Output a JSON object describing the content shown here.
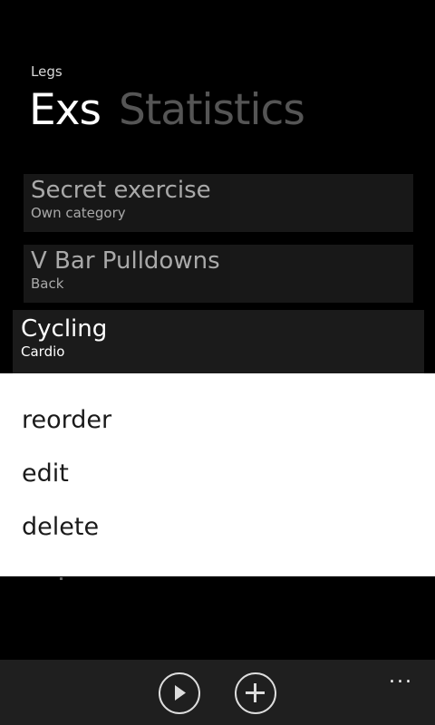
{
  "app": {
    "title": "Legs"
  },
  "pivot": {
    "tabs": [
      {
        "label": "Exs",
        "active": true
      },
      {
        "label": "Statistics",
        "active": false
      }
    ]
  },
  "exercises": [
    {
      "name": "Secret exercise",
      "category": "Own category",
      "state": "dimmed"
    },
    {
      "name": "V Bar Pulldowns",
      "category": "Back",
      "state": "dimmed"
    },
    {
      "name": "Cycling",
      "category": "Cardio",
      "state": "selected"
    }
  ],
  "context_menu": {
    "items": [
      "reorder",
      "edit",
      "delete"
    ]
  },
  "app_bar": {
    "buttons": [
      {
        "icon": "play-icon"
      },
      {
        "icon": "add-icon"
      }
    ],
    "more": "..."
  },
  "colors": {
    "background": "#000000",
    "menu_background": "#ffffff",
    "app_bar": "#1f1f1f",
    "inactive_tab": "#555555"
  }
}
